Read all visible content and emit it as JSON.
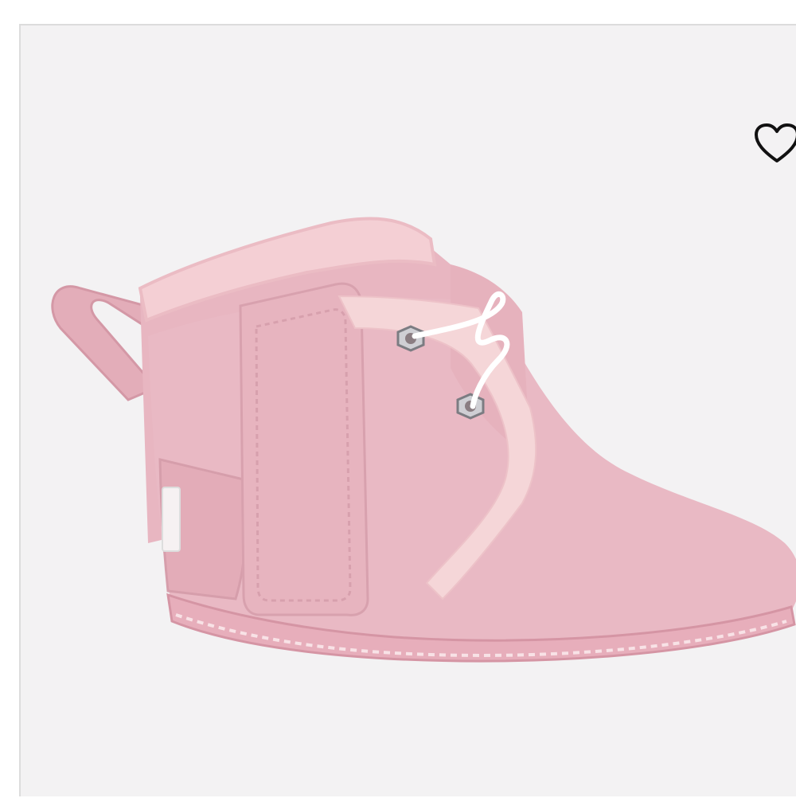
{
  "product_card": {
    "image": {
      "icon": "baby-boot-image",
      "boot_color": "#e9b9c4",
      "trim_color": "#f5d6d8",
      "lace_color": "#ffffff",
      "background_color": "#f3f2f3"
    },
    "wishlist": {
      "icon": "heart-outline-icon",
      "color": "#111111"
    }
  }
}
